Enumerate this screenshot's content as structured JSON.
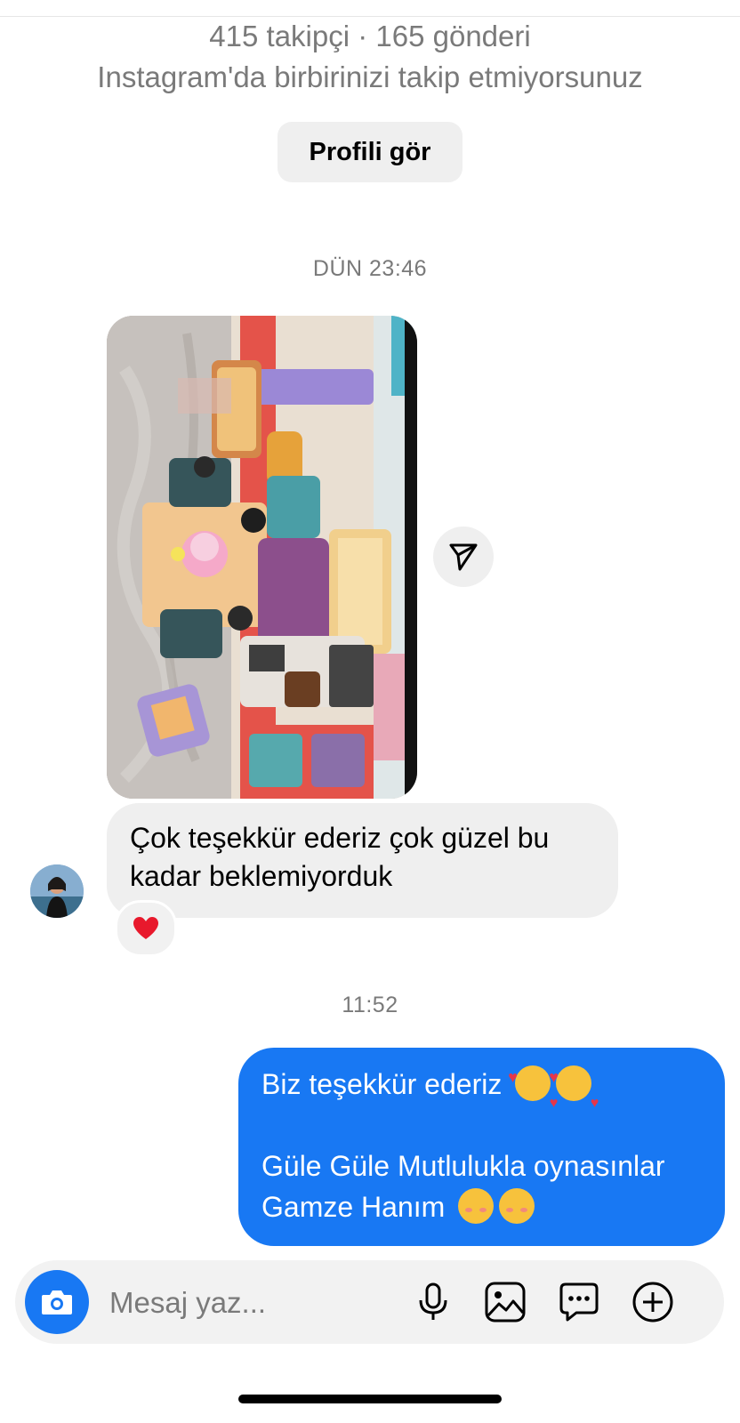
{
  "profile": {
    "stats": "415 takipçi · 165 gönderi",
    "relation": "Instagram'da birbirinizi takip etmiyorsunuz",
    "view_button": "Profili gör"
  },
  "thread": {
    "timestamp_1": "DÜN 23:46",
    "incoming_text_line1": "Çok teşekkür ederiz çok güzel bu",
    "incoming_text_line2": "kadar beklemiyorduk",
    "reaction": "heart-emoji",
    "timestamp_2": "11:52",
    "outgoing_line1": "Biz teşekkür ederiz",
    "outgoing_line2": "Güle Güle Mutlulukla oynasınlar",
    "outgoing_line3": "Gamze Hanım"
  },
  "composer": {
    "placeholder": "Mesaj yaz...",
    "icons": [
      "camera-icon",
      "microphone-icon",
      "gallery-icon",
      "sticker-chat-icon",
      "plus-icon"
    ]
  },
  "colors": {
    "accent": "#1878f3",
    "incoming_bubble": "#efefef",
    "muted_text": "#7a7a7a"
  }
}
